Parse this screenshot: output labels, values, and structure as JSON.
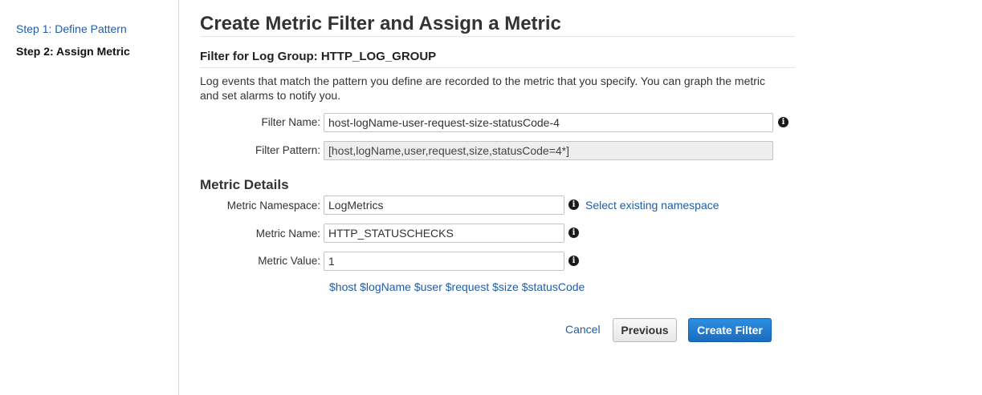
{
  "sidebar": {
    "steps": [
      {
        "label": "Step 1: Define Pattern"
      },
      {
        "label": "Step 2: Assign Metric"
      }
    ]
  },
  "page": {
    "title": "Create Metric Filter and Assign a Metric",
    "subtitle": "Filter for Log Group: HTTP_LOG_GROUP",
    "description": "Log events that match the pattern you define are recorded to the metric that you specify. You can graph the metric and set alarms to notify you."
  },
  "filter": {
    "name_label": "Filter Name:",
    "name_value": "host-logName-user-request-size-statusCode-4",
    "pattern_label": "Filter Pattern:",
    "pattern_value": "[host,logName,user,request,size,statusCode=4*]"
  },
  "metric": {
    "section_title": "Metric Details",
    "namespace_label": "Metric Namespace:",
    "namespace_value": "LogMetrics",
    "select_namespace_link": "Select existing namespace",
    "name_label": "Metric Name:",
    "name_value": "HTTP_STATUSCHECKS",
    "value_label": "Metric Value:",
    "value_value": "1",
    "variables_hint": "$host $logName $user $request $size $statusCode"
  },
  "actions": {
    "cancel": "Cancel",
    "previous": "Previous",
    "create": "Create Filter"
  },
  "icons": {
    "info": "info-icon"
  },
  "colors": {
    "link": "#1f5da8",
    "primary_button": "#1a6cc0"
  }
}
